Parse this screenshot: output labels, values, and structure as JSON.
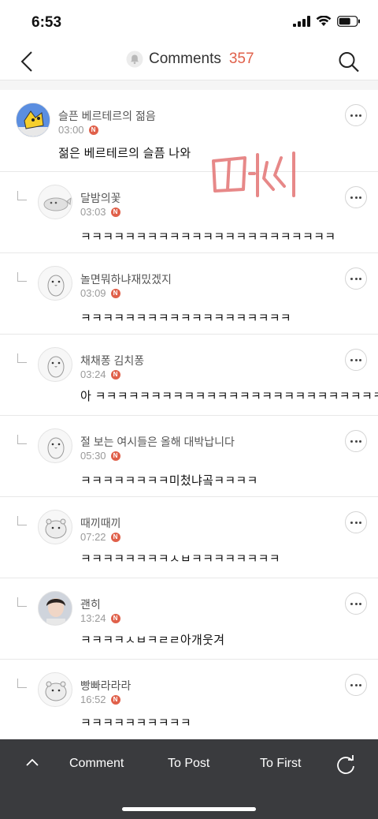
{
  "status_bar": {
    "time": "6:53"
  },
  "nav": {
    "title": "Comments",
    "count": "357"
  },
  "colors": {
    "accent": "#e0604a",
    "bottom_bar": "#3a3b3e"
  },
  "comments": [
    {
      "author": "슬픈 베르테르의 젊음",
      "time": "03:00",
      "body": "젊은 베르테르의 슬픔 나와",
      "reply": false,
      "avatar": "yellow-character-avatar"
    },
    {
      "author": "달밤의꽃",
      "time": "03:03",
      "body": "ㅋㅋㅋㅋㅋㅋㅋㅋㅋㅋㅋㅋㅋㅋㅋㅋㅋㅋㅋㅋㅋㅋㅋ",
      "reply": true,
      "avatar": "seal-avatar"
    },
    {
      "author": "놀면뭐하냐재밌겠지",
      "time": "03:09",
      "body": "ㅋㅋㅋㅋㅋㅋㅋㅋㅋㅋㅋㅋㅋㅋㅋㅋㅋㅋㅋ",
      "reply": true,
      "avatar": "penguin-avatar"
    },
    {
      "author": "채채퐁 김치퐁",
      "time": "03:24",
      "body": "아 ㅋㅋㅋㅋㅋㅋㅋㅋㅋㅋㅋㅋㅋㅋㅋㅋㅋㅋㅋㅋㅋㅋㅋㅋㅋㅋ",
      "reply": true,
      "avatar": "penguin-avatar"
    },
    {
      "author": "절 보는 여시들은 올해 대박납니다",
      "time": "05:30",
      "body": "ㅋㅋㅋㅋㅋㅋㅋㅋ미첬냐곸ㅋㅋㅋㅋ",
      "reply": true,
      "avatar": "penguin-avatar"
    },
    {
      "author": "때끼때끼",
      "time": "07:22",
      "body": "ㅋㅋㅋㅋㅋㅋㅋㅋㅅㅂㅋㅋㅋㅋㅋㅋㅋㅋ",
      "reply": true,
      "avatar": "hippo-avatar"
    },
    {
      "author": "괜히",
      "time": "13:24",
      "body": "ㅋㅋㅋㅋㅅㅂㅋㄹㄹ아개웃겨",
      "reply": true,
      "avatar": "person-photo-avatar"
    },
    {
      "author": "빵빠라라라",
      "time": "16:52",
      "body": "ㅋㅋㅋㅋㅋㅋㅋㅋㅋㅋ",
      "reply": true,
      "avatar": "hippo-avatar"
    }
  ],
  "new_badge": "N",
  "bottom_bar": {
    "comment": "Comment",
    "to_post": "To Post",
    "to_first": "To First"
  }
}
